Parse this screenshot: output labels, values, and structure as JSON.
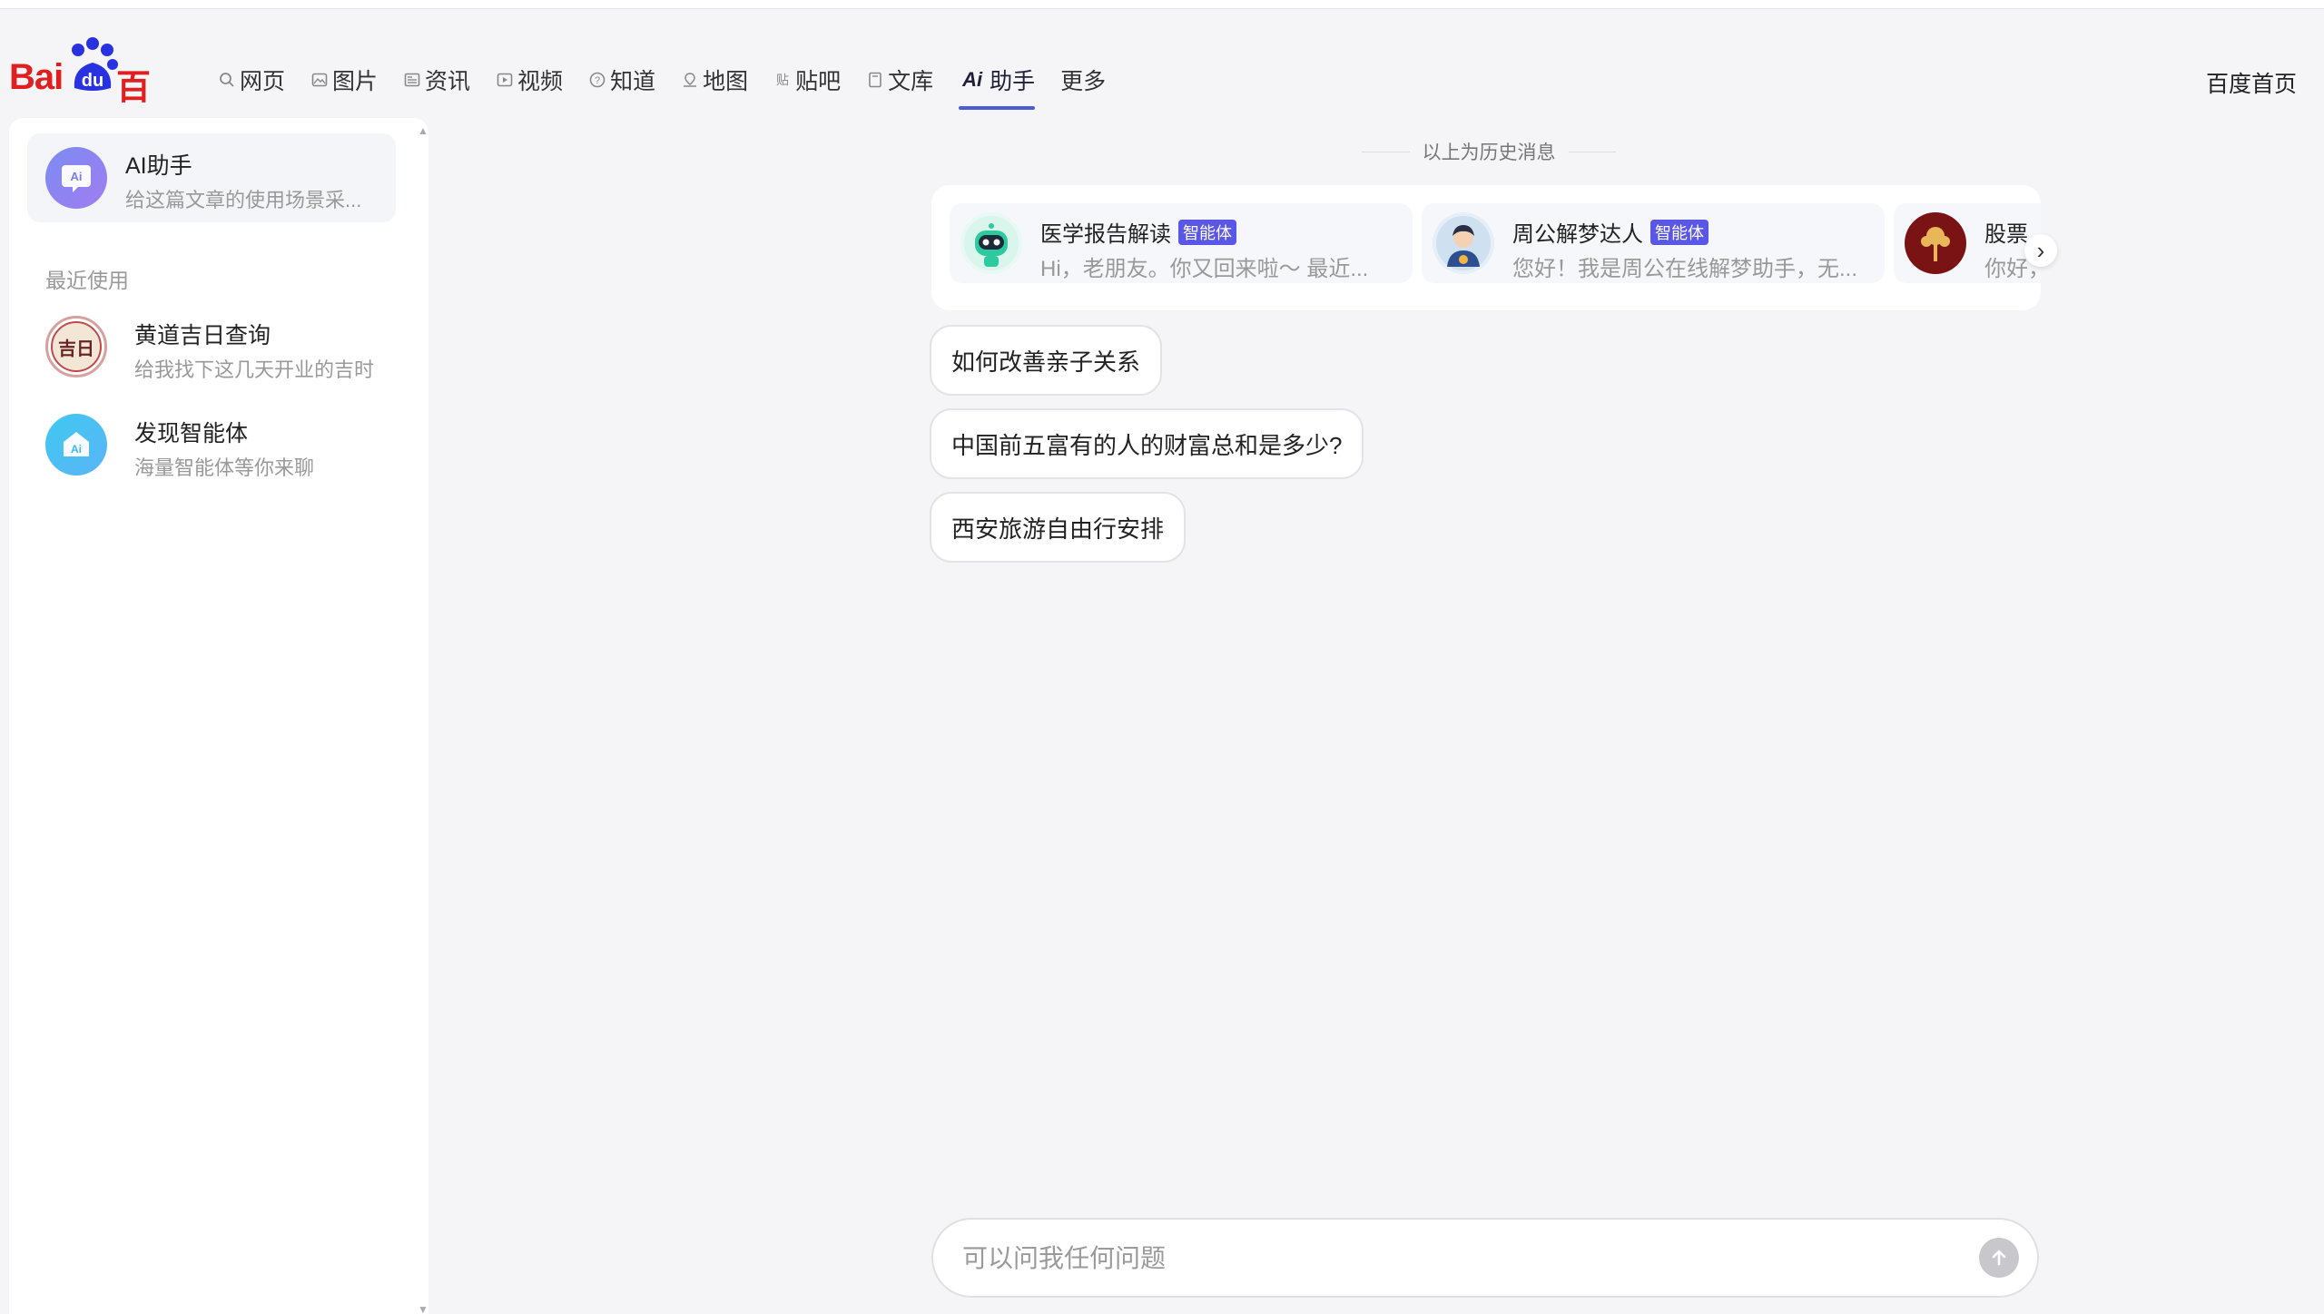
{
  "header": {
    "logo": {
      "latin": "Bai",
      "du": "du",
      "cn": "百度"
    },
    "nav": [
      {
        "label": "网页",
        "icon": "search-icon",
        "active": false
      },
      {
        "label": "图片",
        "icon": "image-icon",
        "active": false
      },
      {
        "label": "资讯",
        "icon": "news-icon",
        "active": false
      },
      {
        "label": "视频",
        "icon": "video-icon",
        "active": false
      },
      {
        "label": "知道",
        "icon": "question-icon",
        "active": false
      },
      {
        "label": "地图",
        "icon": "map-icon",
        "active": false
      },
      {
        "label": "贴吧",
        "icon": "tieba-icon",
        "active": false
      },
      {
        "label": "文库",
        "icon": "document-icon",
        "active": false
      },
      {
        "label": "助手",
        "icon": "ai-icon",
        "active": true
      },
      {
        "label": "更多",
        "icon": "",
        "active": false
      }
    ],
    "home_link": "百度首页"
  },
  "sidebar": {
    "assistant": {
      "title": "AI助手",
      "subtitle": "给这篇文章的使用场景采..."
    },
    "recent_label": "最近使用",
    "recent": [
      {
        "title": "黄道吉日查询",
        "subtitle": "给我找下这几天开业的吉时",
        "avatar_text": "吉日"
      },
      {
        "title": "发现智能体",
        "subtitle": "海量智能体等你来聊"
      }
    ]
  },
  "main": {
    "history_label": "以上为历史消息",
    "agents": [
      {
        "name": "医学报告解读",
        "badge": "智能体",
        "desc": "Hi，老朋友。你又回来啦～ 最近..."
      },
      {
        "name": "周公解梦达人",
        "badge": "智能体",
        "desc": "您好！我是周公在线解梦助手，无..."
      },
      {
        "name": "股票",
        "desc": "你好，"
      }
    ],
    "suggestions": [
      "如何改善亲子关系",
      "中国前五富有的人的财富总和是多少?",
      "西安旅游自由行安排"
    ],
    "input": {
      "placeholder": "可以问我任何问题",
      "value": ""
    }
  },
  "colors": {
    "accent": "#4e5bd6",
    "badge": "#5b57e6",
    "logo_red": "#e02020",
    "logo_blue": "#2932e1"
  }
}
